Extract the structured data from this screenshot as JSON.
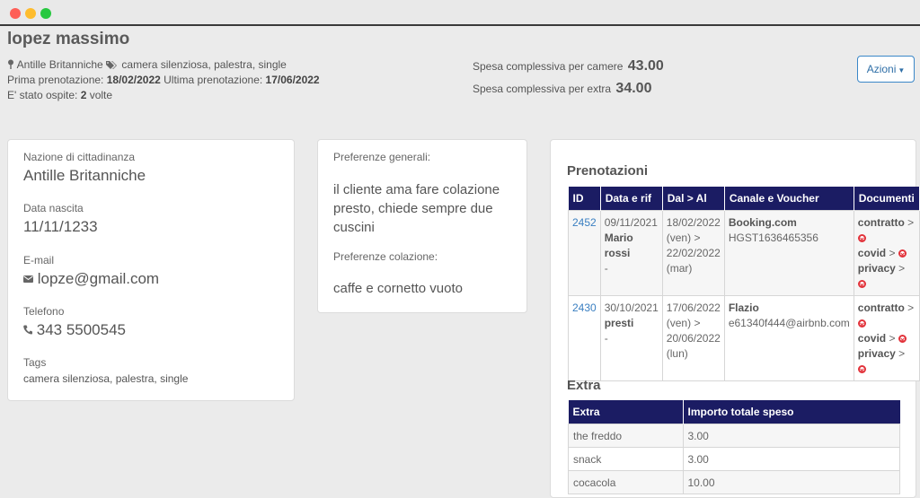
{
  "window": {
    "controls": [
      "close",
      "minimize",
      "maximize"
    ]
  },
  "guest": {
    "name": "lopez massimo",
    "nation": "Antille Britanniche",
    "tags": "camera silenziosa, palestra, single",
    "first_booking_label": "Prima prenotazione:",
    "first_booking": "18/02/2022",
    "last_booking_label": "Ultima prenotazione:",
    "last_booking": "17/06/2022",
    "stays_label": "E' stato ospite:",
    "stays_count": "2",
    "stays_suffix": "volte"
  },
  "spending": {
    "rooms_label": "Spesa complessiva per camere",
    "rooms_amount": "43.00",
    "extra_label": "Spesa complessiva per extra",
    "extra_amount": "34.00"
  },
  "actions": {
    "label": "Azioni"
  },
  "details": {
    "nation_label": "Nazione di cittadinanza",
    "nation_value": "Antille Britanniche",
    "birth_label": "Data nascita",
    "birth_value": "11/11/1233",
    "email_label": "E-mail",
    "email_value": "lopze@gmail.com",
    "phone_label": "Telefono",
    "phone_value": "343 5500545",
    "tags_label": "Tags",
    "tags_value": "camera silenziosa, palestra, single"
  },
  "preferences": {
    "general_label": "Preferenze generali:",
    "general_value": "il cliente ama fare colazione presto, chiede sempre due cuscini",
    "breakfast_label": "Preferenze colazione:",
    "breakfast_value": "caffe e cornetto vuoto"
  },
  "reservations": {
    "title": "Prenotazioni",
    "columns": [
      "ID",
      "Data e rif",
      "Dal > Al",
      "Canale e Voucher",
      "Documenti"
    ],
    "rows": [
      {
        "id": "2452",
        "date": "09/11/2021",
        "ref": "Mario rossi",
        "ref_extra": "-",
        "from": "18/02/2022",
        "from_day": "(ven) >",
        "to": "22/02/2022",
        "to_day": "(mar)",
        "channel": "Booking.com",
        "voucher": "HGST1636465356",
        "doc1": "contratto",
        "doc2": "covid",
        "doc3": "privacy"
      },
      {
        "id": "2430",
        "date": "30/10/2021",
        "ref": "presti",
        "ref_extra": "-",
        "from": "17/06/2022",
        "from_day": "(ven) >",
        "to": "20/06/2022",
        "to_day": "(lun)",
        "channel": "Flazio",
        "voucher": "e61340f444@airbnb.com",
        "doc1": "contratto",
        "doc2": "covid",
        "doc3": "privacy"
      }
    ]
  },
  "extras": {
    "title": "Extra",
    "columns": [
      "Extra",
      "Importo totale speso"
    ],
    "rows": [
      {
        "name": "the freddo",
        "amount": "3.00"
      },
      {
        "name": "snack",
        "amount": "3.00"
      },
      {
        "name": "cocacola",
        "amount": "10.00"
      }
    ]
  },
  "colors": {
    "table_header": "#1b1c63",
    "link": "#3a7fc1",
    "accent": "#3a87c8",
    "doc_error": "#e2323a"
  }
}
